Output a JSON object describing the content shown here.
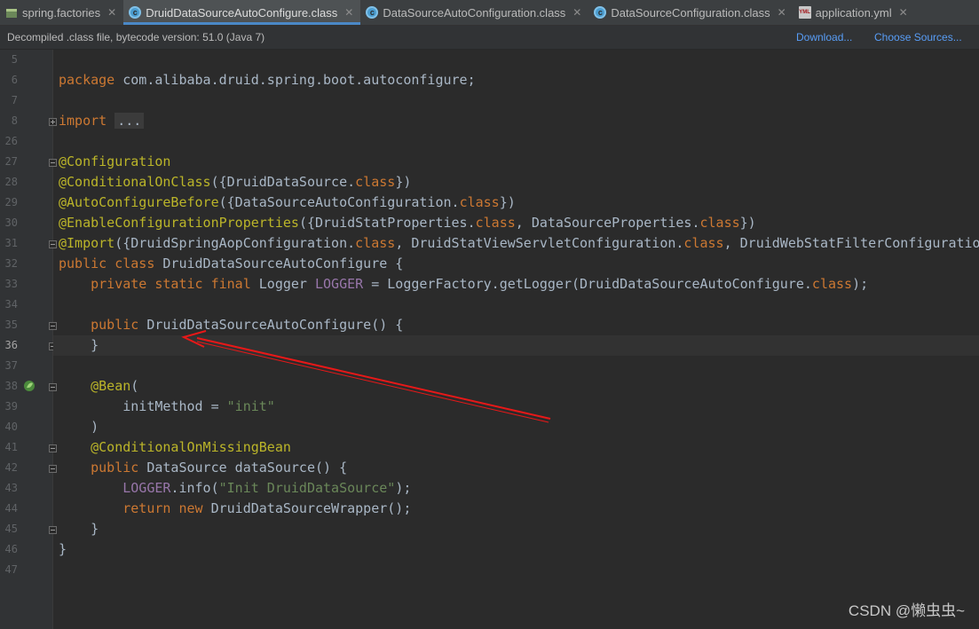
{
  "tabs": [
    {
      "label": "spring.factories",
      "icon": "spring-factories-icon",
      "active": false
    },
    {
      "label": "DruidDataSourceAutoConfigure.class",
      "icon": "class-file-icon",
      "active": true
    },
    {
      "label": "DataSourceAutoConfiguration.class",
      "icon": "class-file-icon",
      "active": false
    },
    {
      "label": "DataSourceConfiguration.class",
      "icon": "class-file-icon",
      "active": false
    },
    {
      "label": "application.yml",
      "icon": "yml-file-icon",
      "active": false
    }
  ],
  "infobar": {
    "message": "Decompiled .class file, bytecode version: 51.0 (Java 7)",
    "download": "Download...",
    "choose_sources": "Choose Sources..."
  },
  "line_numbers": [
    "5",
    "6",
    "7",
    "8",
    "26",
    "27",
    "28",
    "29",
    "30",
    "31",
    "32",
    "33",
    "34",
    "35",
    "36",
    "37",
    "38",
    "39",
    "40",
    "41",
    "42",
    "43",
    "44",
    "45",
    "46",
    "47"
  ],
  "current_line": "36",
  "code": {
    "package_kw": "package",
    "package_name": "com.alibaba.druid.spring.boot.autoconfigure;",
    "import_kw": "import",
    "import_folded": "...",
    "ann_configuration": "@Configuration",
    "ann_conditional_on_class": "@ConditionalOnClass",
    "ann_conditional_on_class_args_a": "({DruidDataSource.",
    "ann_conditional_on_class_args_b": "})",
    "ann_auto_configure_before": "@AutoConfigureBefore",
    "ann_auto_configure_before_args_a": "({DataSourceAutoConfiguration.",
    "ann_auto_configure_before_args_b": "})",
    "ann_enable_config_props": "@EnableConfigurationProperties",
    "ann_enable_config_props_args_a": "({DruidStatProperties.",
    "ann_enable_config_props_args_b": ", DataSourceProperties.",
    "ann_enable_config_props_args_c": "})",
    "ann_import": "@Import",
    "ann_import_args_a": "({DruidSpringAopConfiguration.",
    "ann_import_args_b": ", DruidStatViewServletConfiguration.",
    "ann_import_args_c": ", DruidWebStatFilterConfiguration.",
    "kw_class": "class",
    "kw_public": "public",
    "kw_private_static_final": "private static final",
    "class_decl_name": "DruidDataSourceAutoConfigure {",
    "logger_decl_a": "Logger",
    "logger_field": "LOGGER",
    "logger_decl_b": "= LoggerFactory.getLogger(DruidDataSourceAutoConfigure.",
    "logger_decl_c": ");",
    "constructor": "DruidDataSourceAutoConfigure() {",
    "close_brace": "}",
    "ann_bean": "@Bean",
    "open_paren": "(",
    "init_method_key": "initMethod = ",
    "init_method_value": "\"init\"",
    "close_paren": ")",
    "ann_conditional_on_missing_bean": "@ConditionalOnMissingBean",
    "datasource_method": "DataSource dataSource() {",
    "logger_info_a": ".info(",
    "logger_info_msg": "\"Init DruidDataSource\"",
    "logger_info_b": ");",
    "kw_return": "return",
    "kw_new": "new",
    "return_expr": "DruidDataSourceWrapper();"
  },
  "watermark": "CSDN @懒虫虫~",
  "colors": {
    "background": "#2b2b2b",
    "keyword": "#cc7832",
    "annotation": "#bbb529",
    "string": "#6a8759",
    "field": "#9876aa",
    "text": "#a9b7c6",
    "arrow": "#e81818"
  }
}
